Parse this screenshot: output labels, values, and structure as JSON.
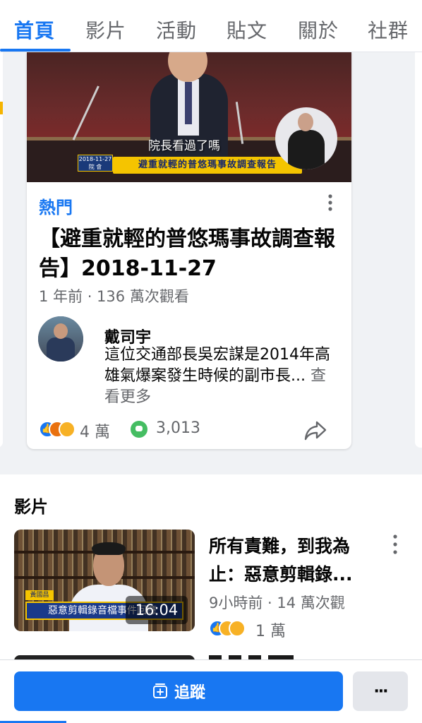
{
  "tabs": [
    {
      "label": "首頁",
      "active": true
    },
    {
      "label": "影片",
      "active": false
    },
    {
      "label": "活動",
      "active": false
    },
    {
      "label": "貼文",
      "active": false
    },
    {
      "label": "關於",
      "active": false
    },
    {
      "label": "社群",
      "active": false
    }
  ],
  "featured": {
    "thumbnail": {
      "caption": "院長看過了嗎",
      "date_line1": "2018-11-27",
      "date_line2": "院 會",
      "banner": "避重就輕的普悠瑪事故調查報告"
    },
    "kicker": "熱門",
    "title": "【避重就輕的普悠瑪事故調查報告】2018-11-27",
    "meta": "1 年前 · 136 萬次觀看",
    "top_comment": {
      "author": "戴司宇",
      "text": "這位交通部長吳宏謀是2014年高雄氣爆案發生時候的副市長...",
      "see_more": " 查看更多"
    },
    "reactions_count": "4 萬",
    "comments_count": "3,013"
  },
  "videos_section": {
    "title": "影片",
    "items": [
      {
        "thumb_name_tag": "黃國昌",
        "thumb_banner": "惡意剪輯錄音檔事件回應",
        "duration": "16:04",
        "title": "所有責難，到我為止：惡意剪輯錄...",
        "meta": "9小時前 · 14 萬次觀",
        "reactions_count": "1 萬"
      }
    ]
  },
  "bottom": {
    "follow_label": "追蹤",
    "more_label": "···"
  },
  "colors": {
    "accent": "#1877f2",
    "secondary_text": "#65676b",
    "like": "#1877f2",
    "angry": "#e9710f",
    "sad": "#f7b125",
    "comment": "#45bd62"
  }
}
